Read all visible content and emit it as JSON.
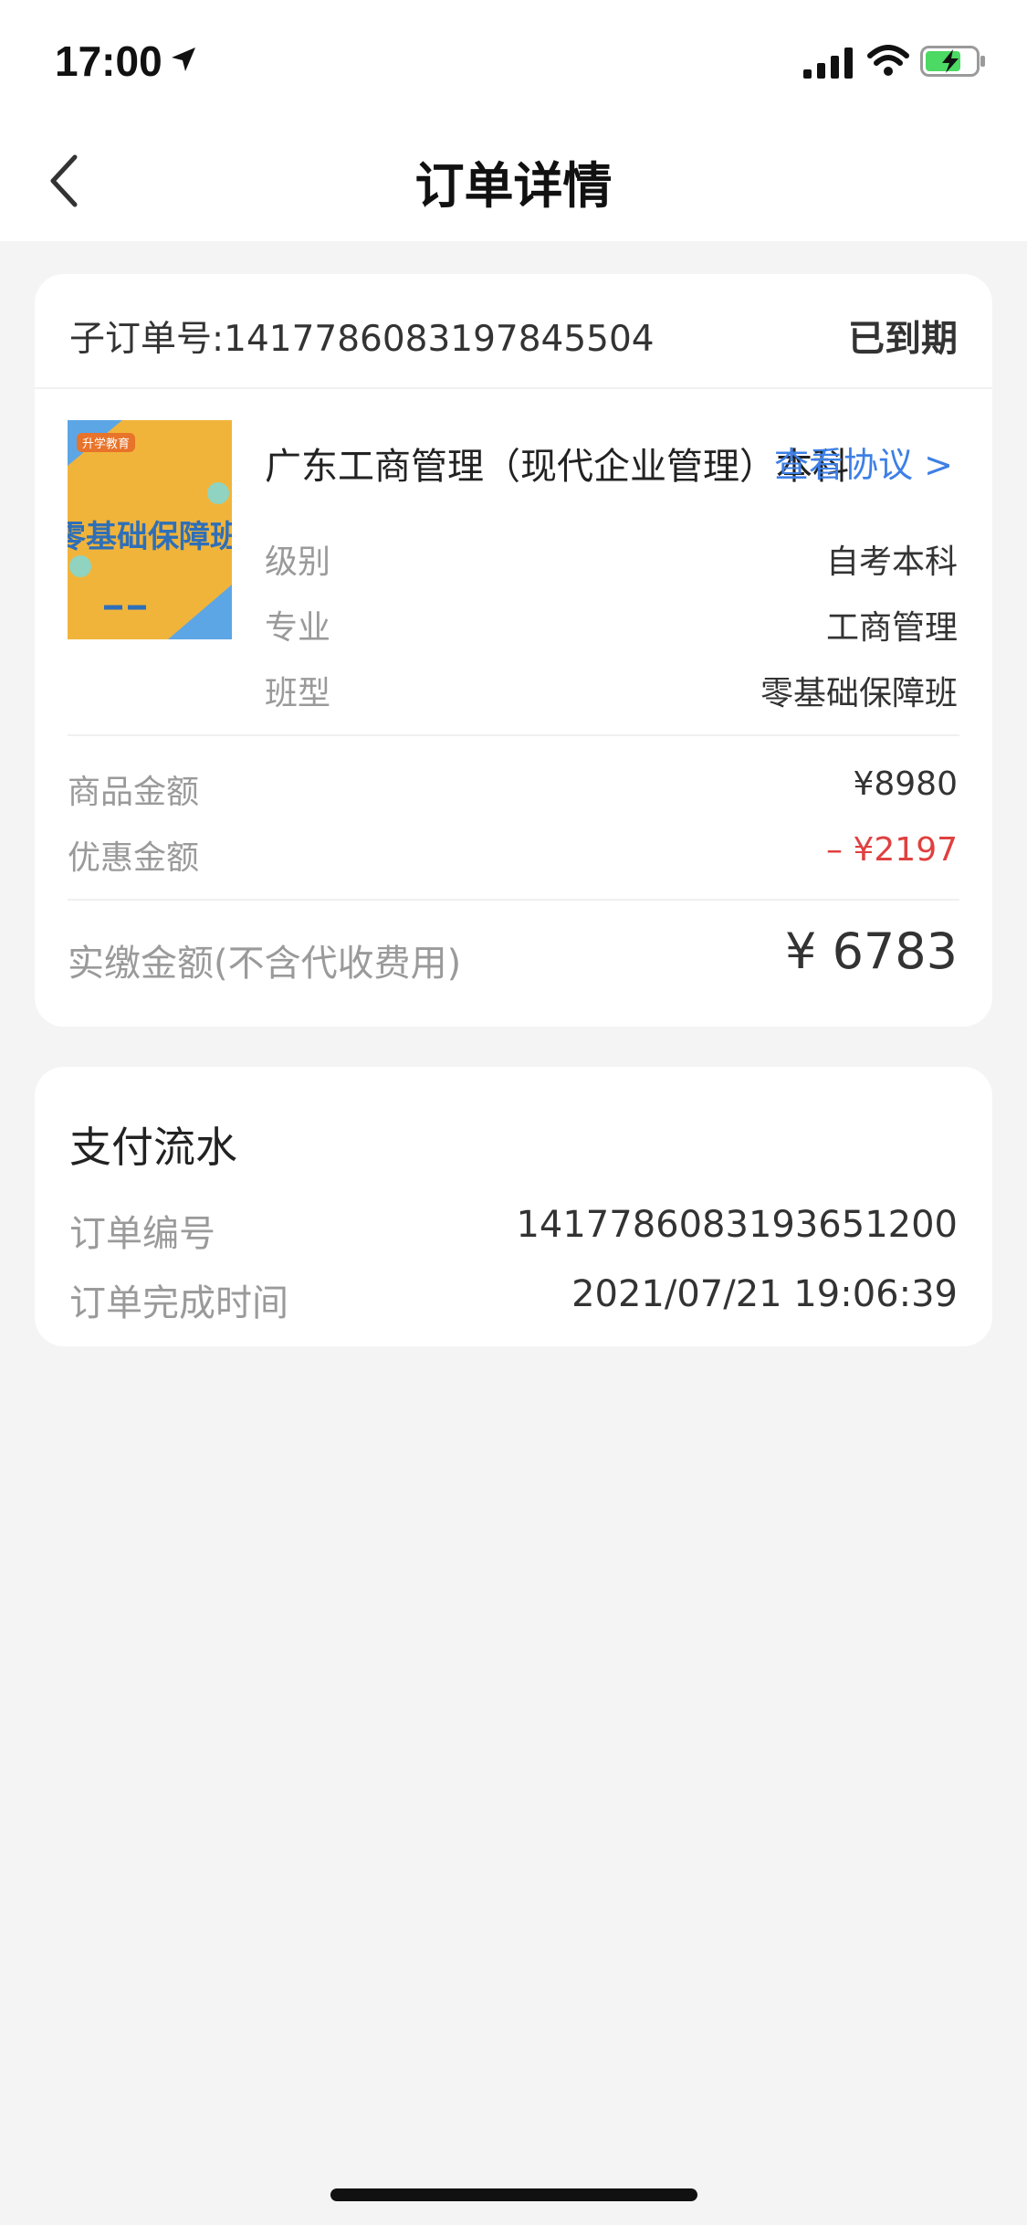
{
  "status_bar": {
    "time": "17:00",
    "icons": [
      "location-arrow-icon",
      "signal-icon",
      "wifi-icon",
      "battery-charging-icon"
    ],
    "battery_color": "#4cd964"
  },
  "header": {
    "title": "订单详情",
    "back_icon": "chevron-left-icon"
  },
  "order": {
    "suborder_label": "子订单号:1417786083197845504",
    "status": "已到期",
    "thumbnail_text": "零基础保障班",
    "thumbnail_brand": "升学教育",
    "product_title": "广东工商管理（现代企业管理）本科",
    "view_protocol": "查看协议 >",
    "details": [
      {
        "label": "级别",
        "value": "自考本科"
      },
      {
        "label": "专业",
        "value": "工商管理"
      },
      {
        "label": "班型",
        "value": "零基础保障班"
      }
    ],
    "goods_amount_label": "商品金额",
    "goods_amount": "¥8980",
    "discount_label": "优惠金额",
    "discount_amount": "– ¥2197",
    "paid_label": "实缴金额(不含代收费用)",
    "paid_amount": "¥ 6783"
  },
  "payment": {
    "title": "支付流水",
    "order_no_label": "订单编号",
    "order_no": "1417786083193651200",
    "complete_time_label": "订单完成时间",
    "complete_time": "2021/07/21 19:06:39"
  },
  "colors": {
    "link": "#3d7fe6",
    "discount": "#e04040",
    "background": "#f4f4f4"
  }
}
